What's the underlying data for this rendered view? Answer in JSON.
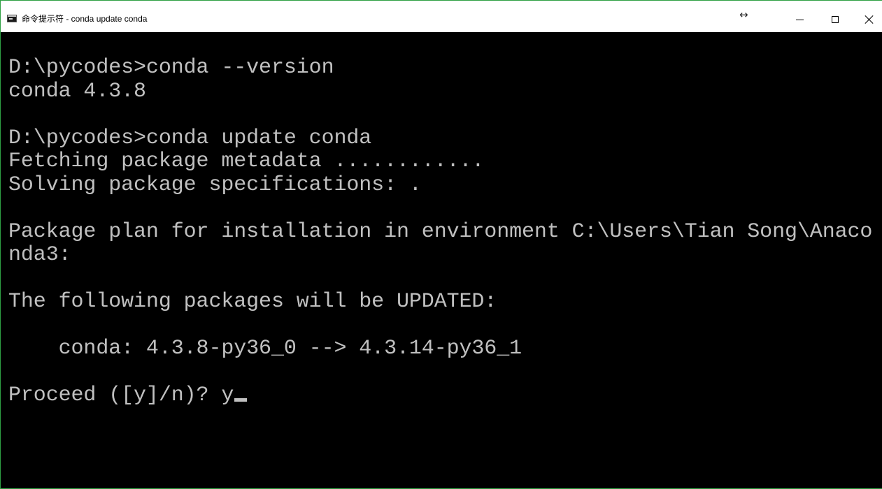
{
  "window": {
    "title": "命令提示符 - conda  update conda",
    "icons": {
      "app": "cmd-icon",
      "resize": "resize-arrows-icon",
      "minimize": "minimize-icon",
      "maximize": "maximize-icon",
      "close": "close-icon"
    },
    "resize_glyph": "↔",
    "accent_border_color": "#2ea043"
  },
  "console": {
    "text_color": "#c0c0c0",
    "background": "#000000",
    "lines": [
      "D:\\pycodes>conda --version",
      "conda 4.3.8",
      "",
      "D:\\pycodes>conda update conda",
      "Fetching package metadata ............",
      "Solving package specifications: .",
      "",
      "Package plan for installation in environment C:\\Users\\Tian Song\\Anaco",
      "nda3:",
      "",
      "The following packages will be UPDATED:",
      "",
      "    conda: 4.3.8-py36_0 --> 4.3.14-py36_1",
      "",
      "Proceed ([y]/n)? y"
    ]
  }
}
